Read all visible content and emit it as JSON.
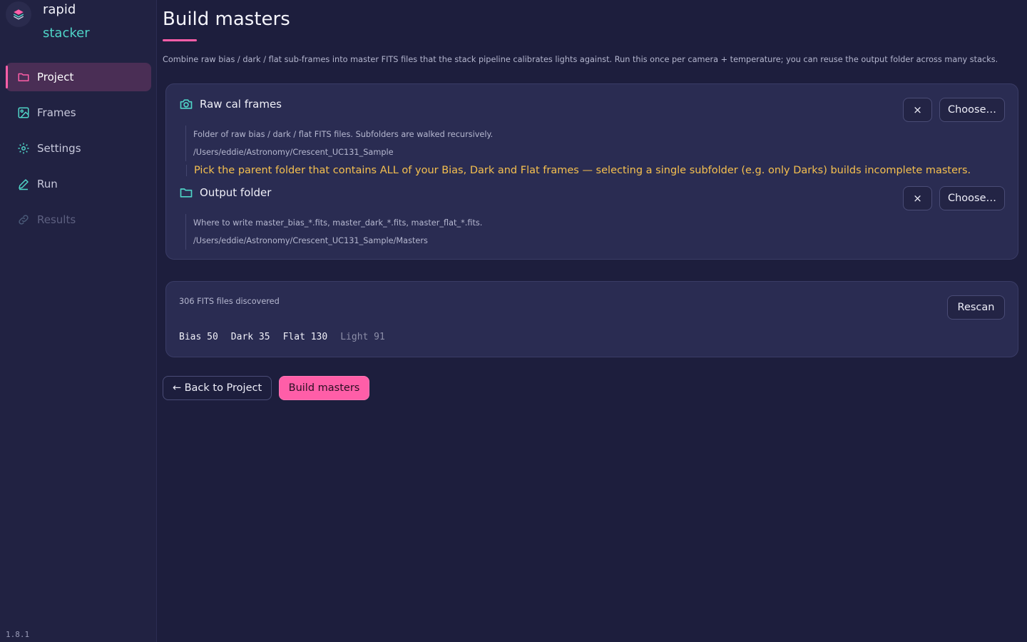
{
  "brand": {
    "line1": "rapid",
    "line2": "stacker",
    "logo_icon": "layers-icon"
  },
  "sidebar": {
    "items": [
      {
        "label": "Project",
        "icon": "folder-icon",
        "active": true
      },
      {
        "label": "Frames",
        "icon": "image-icon",
        "active": false
      },
      {
        "label": "Settings",
        "icon": "gear-icon",
        "active": false
      },
      {
        "label": "Run",
        "icon": "pen-icon",
        "active": false
      },
      {
        "label": "Results",
        "icon": "link-icon",
        "disabled": true
      }
    ],
    "version": "1.8.1"
  },
  "page": {
    "title": "Build masters",
    "description": "Combine raw bias / dark / flat sub-frames into master FITS files that the stack pipeline calibrates lights against. Run this once per camera + temperature; you can reuse the output folder across many stacks."
  },
  "raw_cal": {
    "heading": "Raw cal frames",
    "icon": "camera-icon",
    "help": "Folder of raw bias / dark / flat FITS files. Subfolders are walked recursively.",
    "path": "/Users/eddie/Astronomy/Crescent_UC131_Sample",
    "warning": "Pick the parent folder that contains ALL of your Bias, Dark and Flat frames — selecting a single subfolder (e.g. only Darks) builds incomplete masters.",
    "clear_label": "×",
    "choose_label": "Choose…"
  },
  "output": {
    "heading": "Output folder",
    "icon": "folder-icon",
    "help": "Where to write master_bias_*.fits, master_dark_*.fits, master_flat_*.fits.",
    "path": "/Users/eddie/Astronomy/Crescent_UC131_Sample/Masters",
    "clear_label": "×",
    "choose_label": "Choose…"
  },
  "scan": {
    "summary": "306 FITS files discovered",
    "rescan_label": "Rescan",
    "counts": [
      {
        "label": "Bias 50",
        "muted": false
      },
      {
        "label": "Dark 35",
        "muted": false
      },
      {
        "label": "Flat 130",
        "muted": false
      },
      {
        "label": "Light 91",
        "muted": true
      }
    ]
  },
  "actions": {
    "back_label": "← Back to Project",
    "build_label": "Build masters"
  },
  "colors": {
    "accent": "#ff5ea8",
    "teal": "#4fd4c7",
    "warning": "#f5c04f",
    "background": "#1d1e3d"
  }
}
